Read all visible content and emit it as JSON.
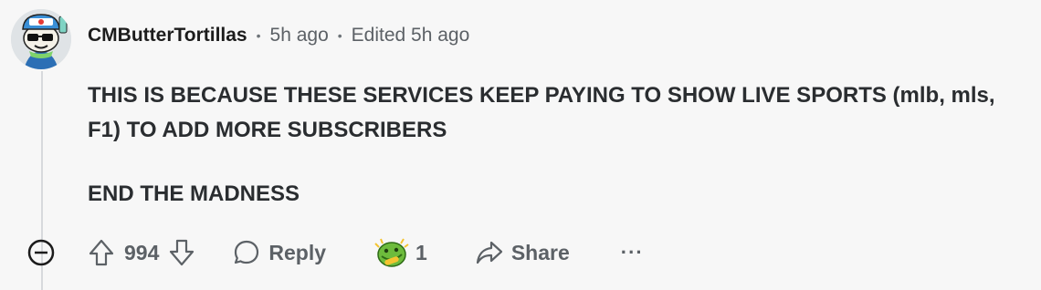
{
  "comment": {
    "author": "CMButterTortillas",
    "meta_separator": "•",
    "posted": "5h ago",
    "edited": "Edited 5h ago",
    "body": [
      "THIS IS BECAUSE THESE SERVICES KEEP PAYING TO SHOW LIVE SPORTS (mlb, mls, F1) TO ADD MORE SUBSCRIBERS",
      "END THE MADNESS"
    ]
  },
  "actions": {
    "score": "994",
    "reply_label": "Reply",
    "award_count": "1",
    "share_label": "Share",
    "more_label": "···"
  },
  "icons": {
    "collapse": "collapse-minus-icon",
    "upvote": "upvote-arrow-icon",
    "downvote": "downvote-arrow-icon",
    "reply": "speech-bubble-icon",
    "award": "award-emoji-icon",
    "share": "share-arrow-icon"
  },
  "colors": {
    "background": "#f7f7f7",
    "muted": "#5c6166",
    "text": "#2a2d30",
    "award_green": "#6dbb3c"
  }
}
